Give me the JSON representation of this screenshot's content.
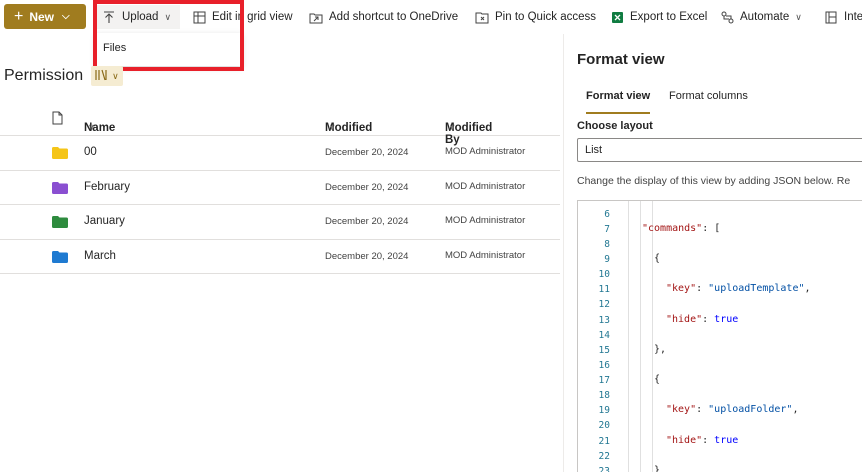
{
  "toolbar": {
    "new_label": "New",
    "upload_label": "Upload",
    "edit_grid_label": "Edit in grid view",
    "add_shortcut_label": "Add shortcut to OneDrive",
    "pin_label": "Pin to Quick access",
    "export_label": "Export to Excel",
    "automate_label": "Automate",
    "integrate_label": "Inte"
  },
  "upload_menu": {
    "files_label": "Files"
  },
  "library": {
    "title": "Permission"
  },
  "columns": {
    "name": "Name",
    "modified": "Modified",
    "modified_by": "Modified By"
  },
  "rows": [
    {
      "name": "00",
      "modified": "December 20, 2024",
      "modified_by": "MOD Administrator",
      "color": "#f5c518"
    },
    {
      "name": "February",
      "modified": "December 20, 2024",
      "modified_by": "MOD Administrator",
      "color": "#8a4fd1"
    },
    {
      "name": "January",
      "modified": "December 20, 2024",
      "modified_by": "MOD Administrator",
      "color": "#2e8b3e"
    },
    {
      "name": "March",
      "modified": "December 20, 2024",
      "modified_by": "MOD Administrator",
      "color": "#1f7ad1"
    }
  ],
  "format_pane": {
    "title": "Format view",
    "tab_format_view": "Format view",
    "tab_format_columns": "Format columns",
    "choose_layout_label": "Choose layout",
    "layout_value": "List",
    "help_text": "Change the display of this view by adding JSON below. Re"
  },
  "code": {
    "line_numbers": [
      "6",
      "7",
      "8",
      "9",
      "10",
      "11",
      "12",
      "13",
      "14",
      "15",
      "16",
      "17",
      "18",
      "19",
      "20",
      "21",
      "22",
      "23"
    ],
    "commands_key": "\"commands\"",
    "key1": "\"key\"",
    "val1": "\"uploadTemplate\"",
    "hide1": "\"hide\"",
    "true1": "true",
    "key2": "\"key\"",
    "val2": "\"uploadFolder\"",
    "hide2": "\"hide\"",
    "true2": "true"
  },
  "colors": {
    "accent": "#a07c1f",
    "highlight": "#e8202a"
  }
}
